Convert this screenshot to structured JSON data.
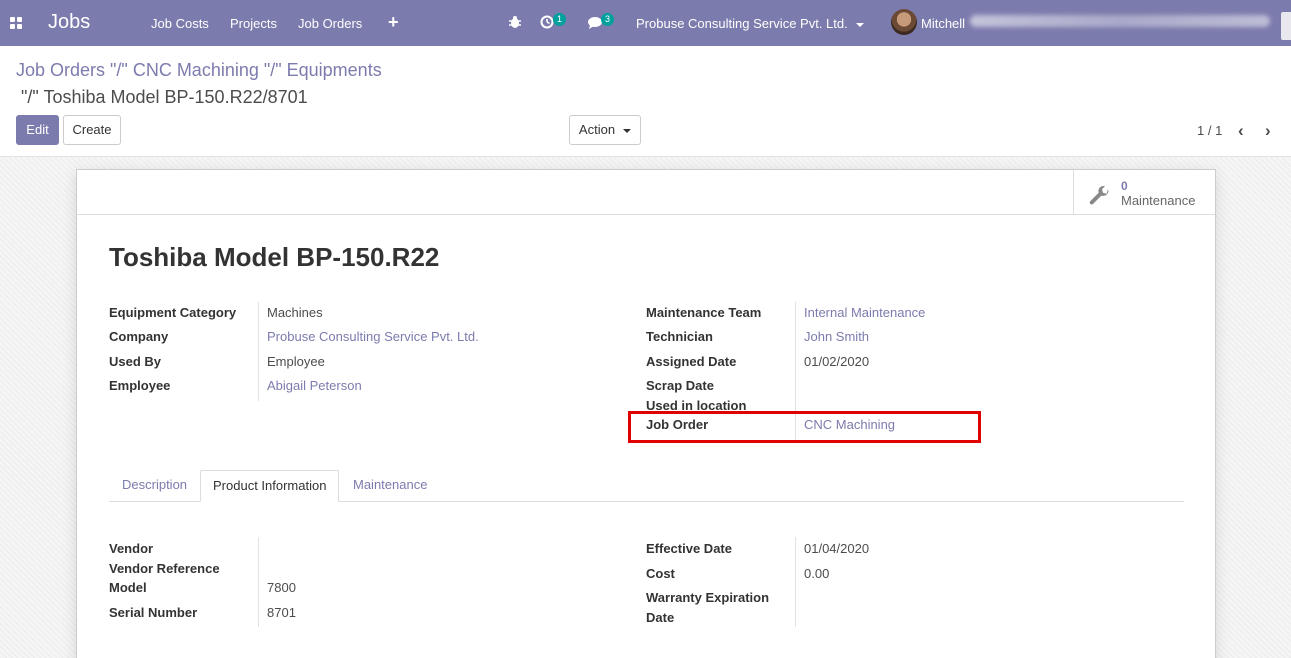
{
  "navbar": {
    "app_name": "Jobs",
    "menu": [
      "Job Costs",
      "Projects",
      "Job Orders"
    ],
    "activity_count": "1",
    "messages_count": "3",
    "company": "Probuse Consulting Service Pvt. Ltd.",
    "user": "Mitchell"
  },
  "control_panel": {
    "breadcrumb_line1": "Job Orders \"/\" CNC Machining \"/\" Equipments",
    "breadcrumb_line2": "\"/\" Toshiba Model BP-150.R22/8701",
    "edit_label": "Edit",
    "create_label": "Create",
    "action_label": "Action",
    "pager": "1 / 1"
  },
  "smart_button": {
    "count": "0",
    "label": "Maintenance"
  },
  "record": {
    "title": "Toshiba Model BP-150.R22"
  },
  "left_fields": [
    {
      "label": "Equipment Category",
      "value": "Machines",
      "link": false
    },
    {
      "label": "Company",
      "value": "Probuse Consulting Service Pvt. Ltd.",
      "link": true
    },
    {
      "label": "Used By",
      "value": "Employee",
      "link": false
    },
    {
      "label": "Employee",
      "value": "Abigail Peterson",
      "link": true
    }
  ],
  "right_fields": [
    {
      "label": "Maintenance Team",
      "value": "Internal Maintenance",
      "link": true
    },
    {
      "label": "Technician",
      "value": "John Smith",
      "link": true
    },
    {
      "label": "Assigned Date",
      "value": "01/02/2020",
      "link": false
    },
    {
      "label": "Scrap Date",
      "value": "",
      "link": false
    },
    {
      "label": "Used in location",
      "value": "",
      "link": false
    },
    {
      "label": "Job Order",
      "value": "CNC Machining",
      "link": true
    }
  ],
  "tabs": [
    "Description",
    "Product Information",
    "Maintenance"
  ],
  "active_tab": "Product Information",
  "product_left": [
    {
      "label": "Vendor",
      "value": ""
    },
    {
      "label": "Vendor Reference",
      "value": ""
    },
    {
      "label": "Model",
      "value": "7800"
    },
    {
      "label": "Serial Number",
      "value": "8701"
    }
  ],
  "product_right": [
    {
      "label": "Effective Date",
      "value": "01/04/2020"
    },
    {
      "label": "Cost",
      "value": "0.00"
    },
    {
      "label": "Warranty Expiration",
      "label_line2": "Date",
      "value": ""
    }
  ],
  "colors": {
    "brand": "#7c7bad",
    "badge": "#00a09d",
    "highlight": "#e00000"
  }
}
